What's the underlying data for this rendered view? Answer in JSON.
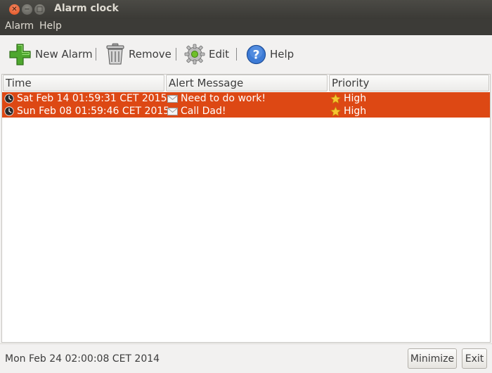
{
  "window": {
    "title": "Alarm clock"
  },
  "menubar": {
    "items": [
      {
        "label": "Alarm"
      },
      {
        "label": "Help"
      }
    ]
  },
  "toolbar": {
    "new_alarm": "New Alarm",
    "remove": "Remove",
    "edit": "Edit",
    "help": "Help",
    "separator": "|"
  },
  "table": {
    "columns": [
      "Time",
      "Alert Message",
      "Priority"
    ],
    "rows": [
      {
        "time": "Sat Feb 14 01:59:31 CET 2015",
        "message": "Need to do work!",
        "priority": "High"
      },
      {
        "time": "Sun Feb 08 01:59:46 CET 2015",
        "message": "Call Dad!",
        "priority": "High"
      }
    ],
    "selection_color": "#dd4814"
  },
  "status": {
    "text": "Mon Feb 24 02:00:08 CET 2014"
  },
  "buttons": {
    "minimize": "Minimize",
    "exit": "Exit"
  },
  "icons": {
    "close": "close-icon",
    "minimize": "minimize-icon",
    "maximize": "maximize-icon",
    "new_alarm": "plus-icon",
    "remove": "trash-icon",
    "edit": "gear-icon",
    "help": "question-icon",
    "time": "clock-icon",
    "message": "envelope-icon",
    "priority": "star-icon"
  }
}
